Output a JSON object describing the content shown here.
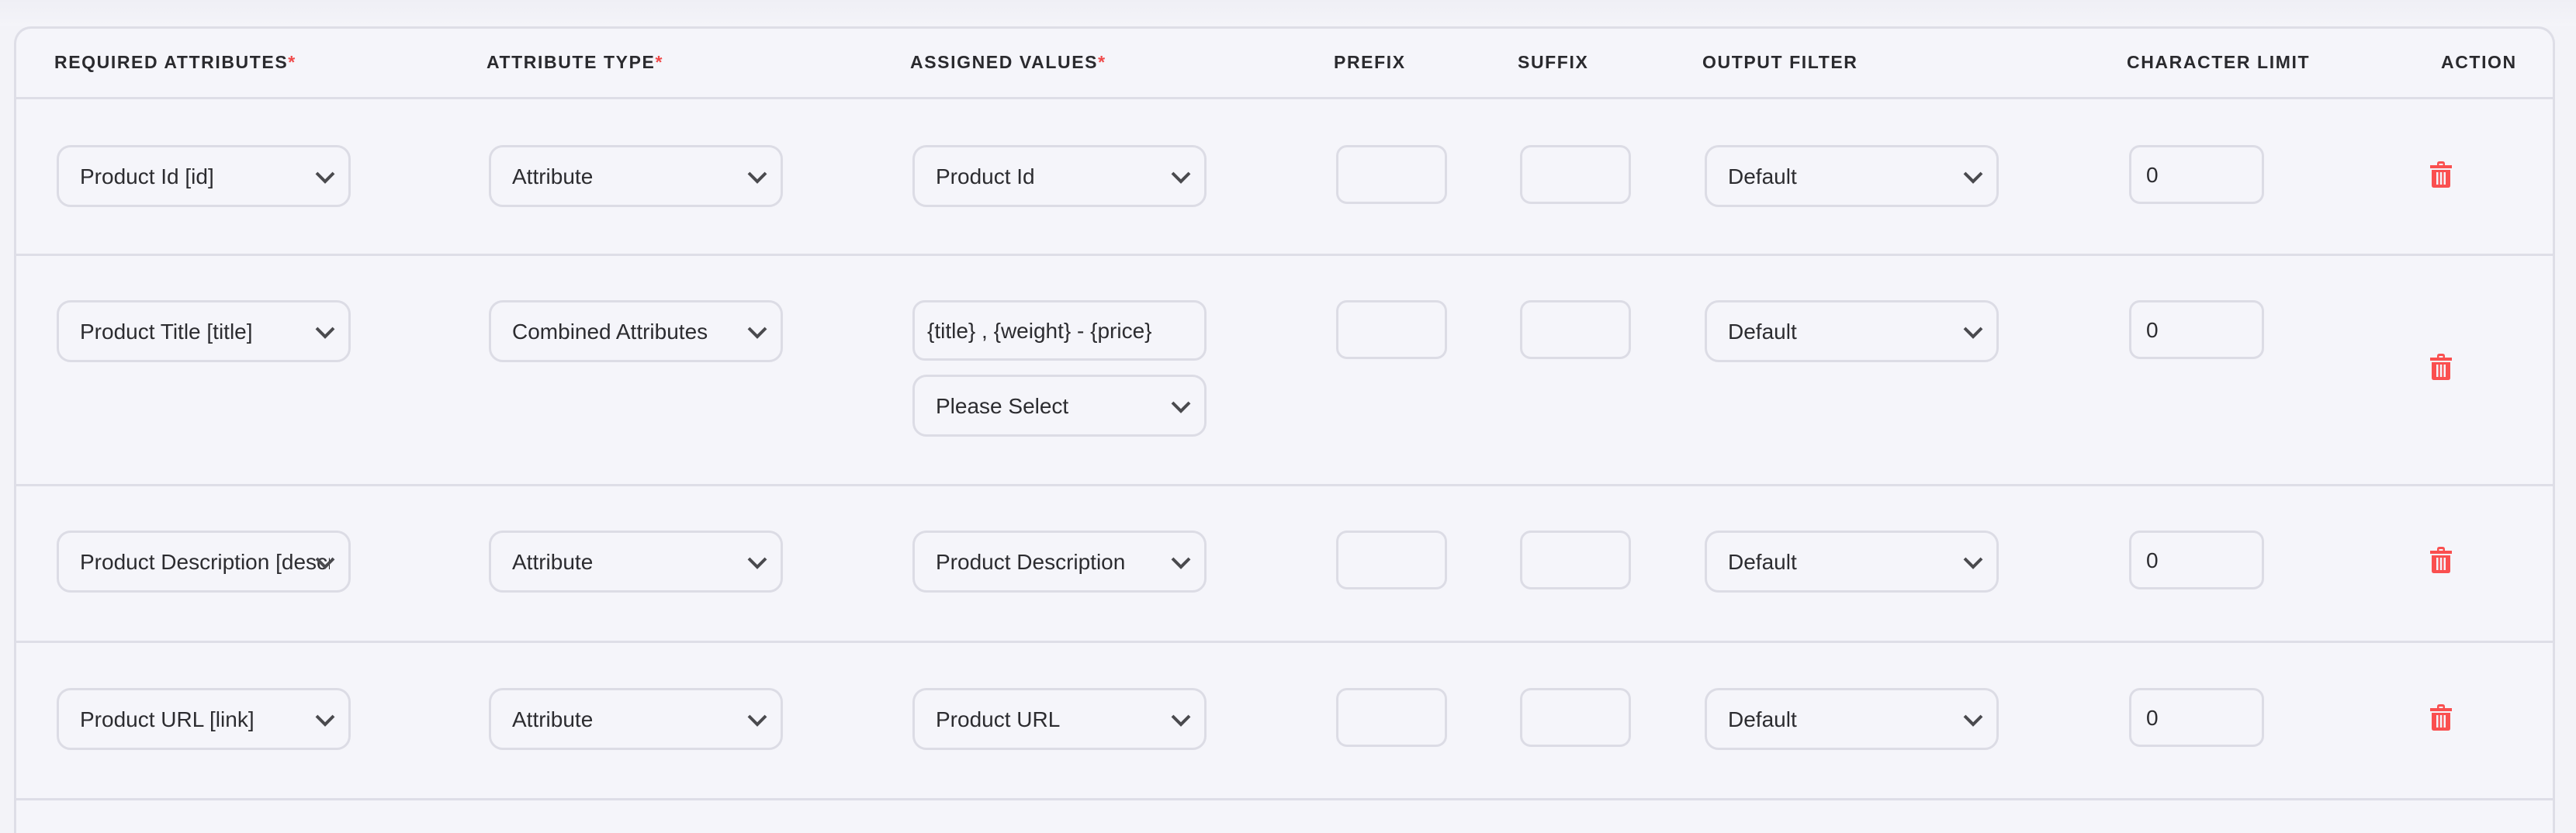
{
  "table": {
    "columns": [
      {
        "label": "REQUIRED ATTRIBUTES",
        "required": true
      },
      {
        "label": "ATTRIBUTE TYPE",
        "required": true
      },
      {
        "label": "ASSIGNED VALUES",
        "required": true
      },
      {
        "label": "PREFIX",
        "required": false
      },
      {
        "label": "SUFFIX",
        "required": false
      },
      {
        "label": "OUTPUT FILTER",
        "required": false
      },
      {
        "label": "CHARACTER LIMIT",
        "required": false
      },
      {
        "label": "ACTION",
        "required": false
      }
    ],
    "required_marker": "*",
    "rows": [
      {
        "required_attribute": "Product Id [id]",
        "attribute_type": "Attribute",
        "assigned_value": "Product Id",
        "prefix": "",
        "suffix": "",
        "output_filter": "Default",
        "character_limit": "0",
        "action_icon": "trash-icon"
      },
      {
        "required_attribute": "Product Title [title]",
        "attribute_type": "Combined Attributes",
        "assigned_value_text": "{title} , {weight} - {price}",
        "assigned_value": "Please Select",
        "prefix": "",
        "suffix": "",
        "output_filter": "Default",
        "character_limit": "0",
        "action_icon": "trash-icon"
      },
      {
        "required_attribute": "Product Description [description]",
        "attribute_type": "Attribute",
        "assigned_value": "Product Description",
        "prefix": "",
        "suffix": "",
        "output_filter": "Default",
        "character_limit": "0",
        "action_icon": "trash-icon"
      },
      {
        "required_attribute": "Product URL [link]",
        "attribute_type": "Attribute",
        "assigned_value": "Product URL",
        "prefix": "",
        "suffix": "",
        "output_filter": "Default",
        "character_limit": "0",
        "action_icon": "trash-icon"
      }
    ]
  },
  "colors": {
    "delete": "#fa4f4f",
    "required_marker": "#f04a4a",
    "border": "#dedee7",
    "background": "#f5f5fa"
  }
}
